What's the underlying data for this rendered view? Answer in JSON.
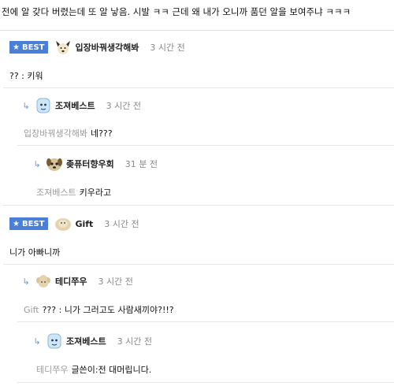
{
  "post": {
    "text": "전에 알 갖다 버렸는데 또 알 낳음. 시발 ㅋㅋ 근데 왜 내가 오니까 품던 알을 보여주냐 ㅋㅋㅋ"
  },
  "badge_label": "BEST",
  "comments": [
    {
      "nick": "입장바꿔생각해봐",
      "time": "3 시간 전",
      "mention": "",
      "text": "?? : 키워",
      "best": true,
      "avatar": "dog-avatar-icon"
    },
    {
      "nick": "조져베스트",
      "time": "3 시간 전",
      "mention": "입장바꿔생각해봐",
      "text": "네???",
      "best": false,
      "avatar": "blue-character-avatar-icon"
    },
    {
      "nick": "좆퓨터향우회",
      "time": "31 분 전",
      "mention": "조져베스트",
      "text": "키우라고",
      "best": false,
      "avatar": "dog-face-avatar-icon"
    },
    {
      "nick": "Gift",
      "time": "3 시간 전",
      "mention": "",
      "text": "니가 아빠니까",
      "best": true,
      "avatar": "puppy-avatar-icon"
    },
    {
      "nick": "테디쭈우",
      "time": "3 시간 전",
      "mention": "Gift",
      "text": "??? : 니가 그러고도 사람새끼야?!!?",
      "best": false,
      "avatar": "poodle-avatar-icon"
    },
    {
      "nick": "조져베스트",
      "time": "3 시간 전",
      "mention": "테디쭈우",
      "text": "글쓴이:전 대머립니다.",
      "best": false,
      "avatar": "blue-character-avatar-icon"
    }
  ]
}
